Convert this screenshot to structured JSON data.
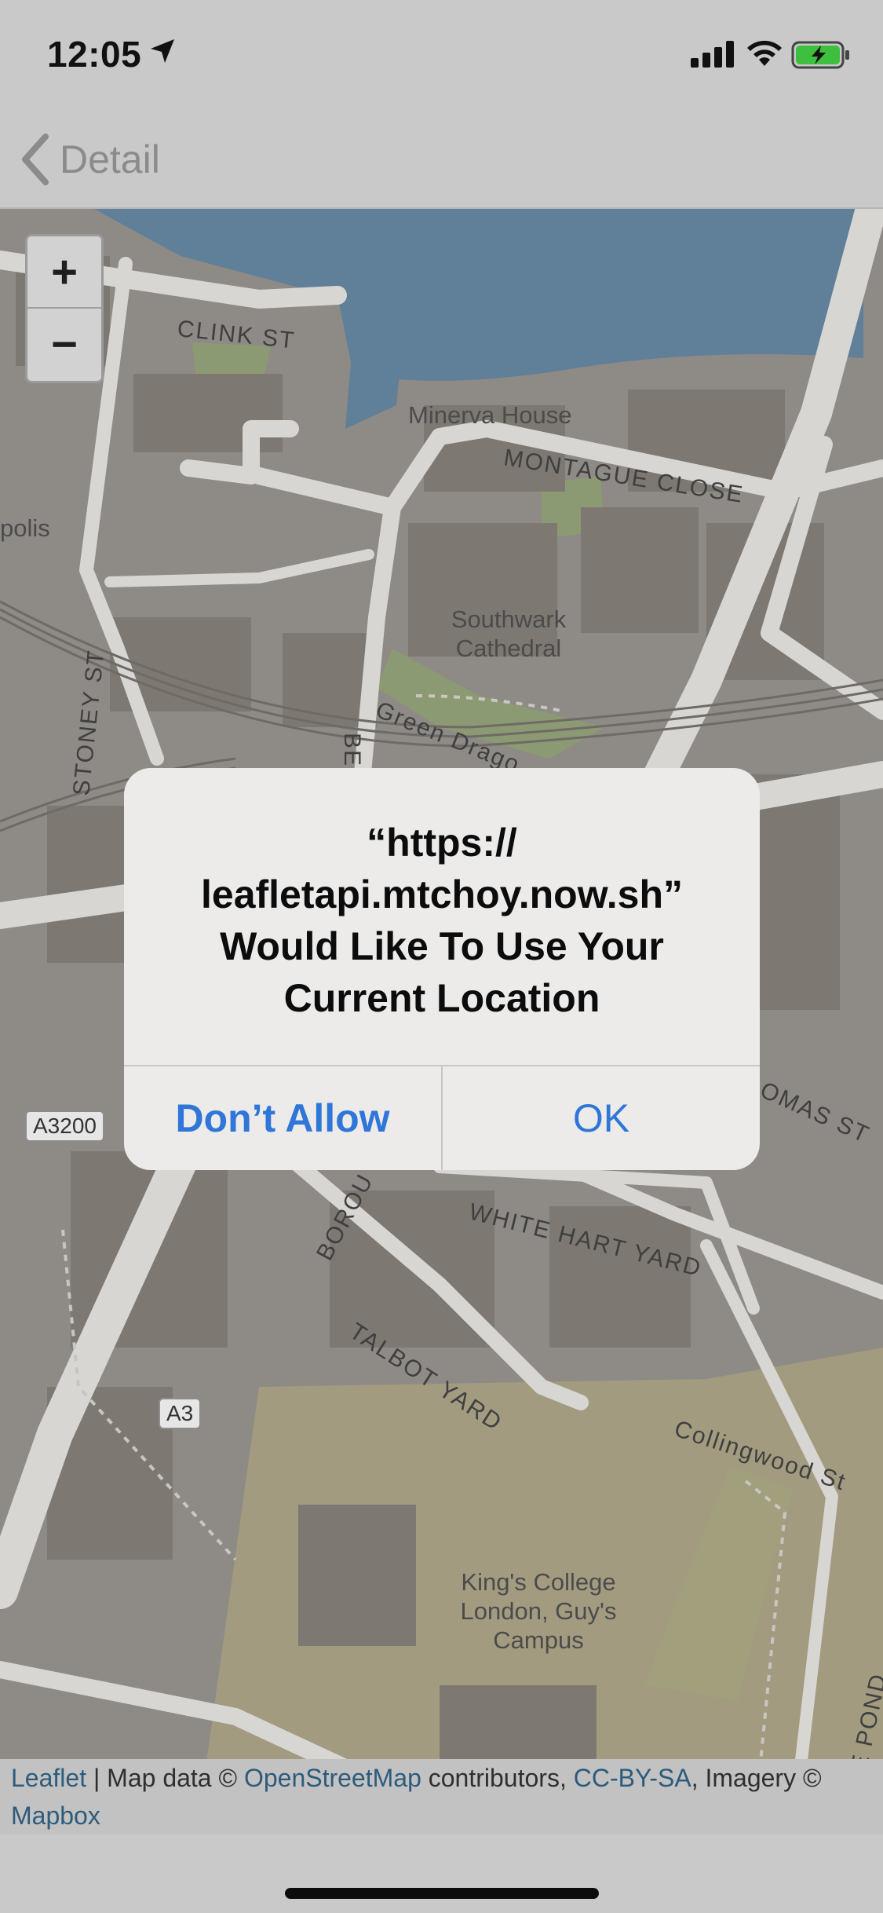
{
  "status_bar": {
    "time": "12:05",
    "icons": [
      "location-arrow-icon",
      "cellular-signal-icon",
      "wifi-icon",
      "battery-charging-icon"
    ]
  },
  "nav": {
    "back_label": "Detail"
  },
  "map": {
    "zoom_in": "+",
    "zoom_out": "−",
    "labels": {
      "minerva_house": "Minerva House",
      "southwark_cathedral": "Southwark Cathedral",
      "kings_college": "King's College London, Guy's Campus",
      "polis": "polis"
    },
    "streets": {
      "clink_st": "CLINK ST",
      "montague_close": "MONTAGUE CLOSE",
      "green_dragon": "Green Drago",
      "stoney_st": "STONEY ST",
      "bedale": "BED",
      "borough": "BOROU",
      "white_hart_yard": "WHITE HART YARD",
      "talbot_yard": "TALBOT YARD",
      "collingwood_st": "Collingwood St",
      "thomas_st": "OMAS ST",
      "maze_pond": "MAZE POND"
    },
    "road_badges": {
      "a3200": "A3200",
      "a3": "A3"
    },
    "attribution": {
      "leaflet": "Leaflet",
      "sep": " | Map data © ",
      "osm": "OpenStreetMap",
      "contrib": " contributors, ",
      "license": "CC-BY-SA",
      "imagery": ", Imagery © ",
      "mapbox": "Mapbox"
    }
  },
  "alert": {
    "title_line1": "“https://",
    "title_line2": "leafletapi.mtchoy.now.sh”",
    "title_line3": "Would Like To Use Your",
    "title_line4": "Current Location",
    "deny_label": "Don’t Allow",
    "ok_label": "OK",
    "accent_color": "#2f76d8"
  }
}
